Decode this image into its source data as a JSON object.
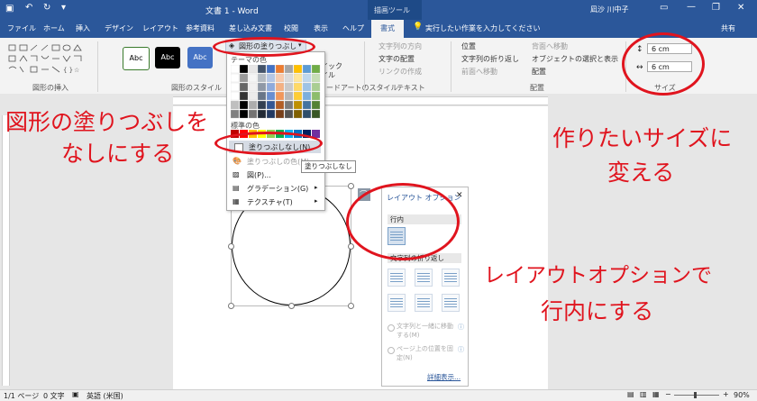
{
  "titlebar": {
    "title": "文書 1 - Word",
    "contextual": "描画ツール",
    "user": "凪沙 川中子",
    "undo_icon": "undo-icon",
    "redo_icon": "redo-icon"
  },
  "tabs": [
    "ファイル",
    "ホーム",
    "挿入",
    "デザイン",
    "レイアウト",
    "参考資料",
    "差し込み文書",
    "校閲",
    "表示",
    "ヘルプ",
    "書式"
  ],
  "tellme": "実行したい作業を入力してください",
  "share": "共有",
  "ribbon": {
    "groups": {
      "insert_shapes": "図形の挿入",
      "styles": "図形のスタイル",
      "wordart": "ワードアートのスタイル",
      "text": "テキスト",
      "arrange": "配置",
      "size": "サイズ"
    },
    "style_samples": [
      "Abc",
      "Abc",
      "Abc"
    ],
    "fill_button": "図形の塗りつぶし",
    "wordart_partial": [
      "イック",
      "イル"
    ],
    "text_items": [
      "文字列の方向",
      "文字の配置",
      "リンクの作成"
    ],
    "arrange_items": [
      "位置",
      "文字列の折り返し",
      "前面へ移動",
      "背面へ移動",
      "オブジェクトの選択と表示",
      "配置"
    ],
    "height": "6 cm",
    "width": "6 cm"
  },
  "dropdown": {
    "theme_colors": "テーマの色",
    "standard_colors": "標準の色",
    "no_fill": "塗りつぶしなし(N)",
    "more_colors": "塗りつぶしの色(M)...",
    "picture": "図(P)...",
    "gradient": "グラデーション(G)",
    "texture": "テクスチャ(T)",
    "tooltip": "塗りつぶしなし"
  },
  "layout_panel": {
    "title": "レイアウト オプション",
    "inline": "行内",
    "wrap": "文字列の折り返し",
    "move_with_text": "文字列と一緒に移動する(M)",
    "fix_position": "ページ上の位置を固定(N)",
    "details": "詳細表示..."
  },
  "notes": {
    "fill": [
      "図形の塗りつぶしを",
      "なしにする"
    ],
    "size": [
      "作りたいサイズに",
      "変える"
    ],
    "layout": [
      "レイアウトオプションで",
      "行内にする"
    ]
  },
  "status": {
    "pages": "1/1 ページ",
    "words": "0 文字",
    "lang": "英語 (米国)",
    "zoom": "90%"
  },
  "colors": {
    "accent": "#2b579a",
    "annotation": "#e0141e"
  }
}
